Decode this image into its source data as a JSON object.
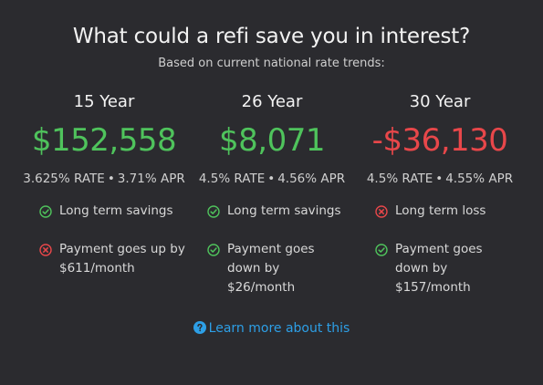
{
  "header": {
    "title": "What could a refi save you in interest?",
    "subtitle": "Based on current national rate trends:"
  },
  "colors": {
    "positive": "#4fc35c",
    "negative": "#e8474a",
    "link": "#2d9fe6",
    "background": "#2b2b2f"
  },
  "options": [
    {
      "term": "15 Year",
      "amount": "$152,558",
      "amount_sign": "positive",
      "rate": "3.625% RATE",
      "separator": "•",
      "apr": "3.71% APR",
      "items": [
        {
          "icon": "check-circle-icon",
          "status": "positive",
          "text": "Long term savings"
        },
        {
          "icon": "x-circle-icon",
          "status": "negative",
          "text": "Payment goes up by $611/month"
        }
      ]
    },
    {
      "term": "26 Year",
      "amount": "$8,071",
      "amount_sign": "positive",
      "rate": "4.5% RATE",
      "separator": "•",
      "apr": "4.56% APR",
      "items": [
        {
          "icon": "check-circle-icon",
          "status": "positive",
          "text": "Long term savings"
        },
        {
          "icon": "check-circle-icon",
          "status": "positive",
          "text": "Payment goes down by $26/month"
        }
      ]
    },
    {
      "term": "30 Year",
      "amount": "-$36,130",
      "amount_sign": "negative",
      "rate": "4.5% RATE",
      "separator": "•",
      "apr": "4.55% APR",
      "items": [
        {
          "icon": "x-circle-icon",
          "status": "negative",
          "text": "Long term loss"
        },
        {
          "icon": "check-circle-icon",
          "status": "positive",
          "text": "Payment goes down by $157/month"
        }
      ]
    }
  ],
  "learn_more": {
    "icon": "question-circle-icon",
    "label": "Learn more about this"
  }
}
